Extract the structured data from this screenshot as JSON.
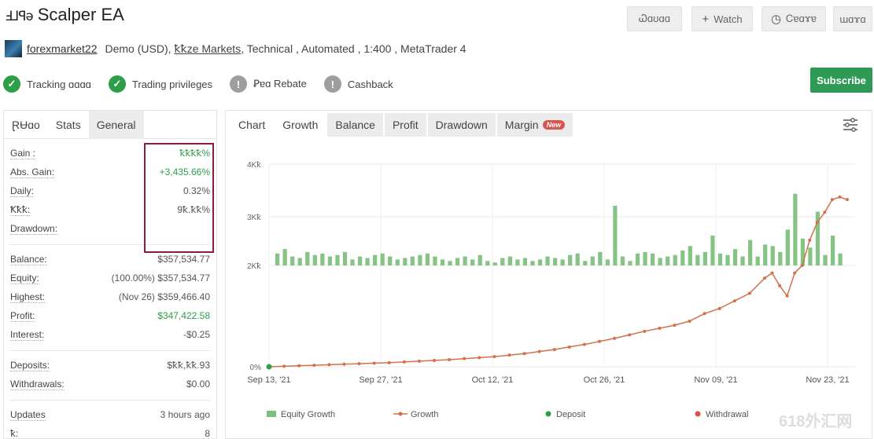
{
  "header": {
    "logo_text": "Ⅎ⅃ꟼǝ",
    "title": "Scalper EA"
  },
  "top_buttons": [
    {
      "label": "Ꮗɑʊɑɑ",
      "icon": ""
    },
    {
      "label": "Watch",
      "icon": "+"
    },
    {
      "label": "Ꮯɐɑɤɐ",
      "icon": "◷"
    },
    {
      "label": "ɯɑɤɑ",
      "icon": ""
    }
  ],
  "meta": {
    "username": "forexmarket22",
    "account": "Demo (USD),",
    "broker": "ꝁꝁze Markets",
    "rest": ", Technical , Automated , 1:400 , MetaTrader 4"
  },
  "badges": [
    {
      "label": "Tracking ɑɑɑɑ",
      "icon": "check-icon",
      "color": "#2e9e4a"
    },
    {
      "label": "Trading privileges",
      "icon": "check-icon",
      "color": "#2e9e4a"
    },
    {
      "label": "Ꝑɐɑ Rebate",
      "icon": "alert-icon",
      "color": "#9e9e9e"
    },
    {
      "label": "Cashback",
      "icon": "alert-icon",
      "color": "#9e9e9e"
    }
  ],
  "subscribe_label": "Subscribe",
  "left_tabs": [
    "ⱤɄɑo",
    "Stats",
    "General"
  ],
  "stats_top": [
    {
      "label": "Gain :",
      "value": "ꝁꝁꝁꝁ%",
      "green": true
    },
    {
      "label": "Abs. Gain:",
      "value": "+3,435.66%",
      "green": true
    },
    {
      "label": "Daily:",
      "value": "0.32%",
      "green": false
    },
    {
      "label": "Ꝁꝁꝁ:",
      "value": "9ꝁ.ꝁꝁ%",
      "green": false
    },
    {
      "label": "Drawdown:",
      "value": "",
      "green": false
    }
  ],
  "stats_balance": [
    {
      "label": "Balance:",
      "value": "$357,534.77",
      "green": false
    },
    {
      "label": "Equity:",
      "value": "(100.00%) $357,534.77",
      "green": false
    },
    {
      "label": "Highest:",
      "value": "(Nov 26) $359,466.40",
      "green": false
    },
    {
      "label": "Profit:",
      "value": "$347,422.58",
      "green": true
    },
    {
      "label": "Interest:",
      "value": "-$0.25",
      "green": false
    }
  ],
  "stats_deposits": [
    {
      "label": "Deposits:",
      "value": "$ꝁꝁ,ꝁꝁ.93",
      "green": false
    },
    {
      "label": "Withdrawals:",
      "value": "$0.00",
      "green": false
    }
  ],
  "stats_updates": [
    {
      "label": "Updates",
      "value": "3 hours ago",
      "green": false
    },
    {
      "label": "ꝁ:",
      "value": "8",
      "green": false
    }
  ],
  "right_tabs": [
    "Chart",
    "Growth",
    "Balance",
    "Profit",
    "Drawdown",
    "Margin"
  ],
  "new_badge": "New",
  "chart_data": {
    "type": "line",
    "y_ticks": [
      "4Kꝁ",
      "3Kꝁ",
      "2Kꝁ",
      "0%"
    ],
    "x_ticks": [
      "Sep 13, '21",
      "Sep 27, '21",
      "Oct 12, '21",
      "Oct 26, '21",
      "Nov 09, '21",
      "Nov 23, '21"
    ],
    "x_range": [
      0,
      77
    ],
    "y_range": [
      0,
      4000
    ],
    "growth_series": {
      "name": "Growth",
      "x": [
        0,
        2,
        4,
        6,
        8,
        10,
        12,
        14,
        16,
        18,
        20,
        22,
        24,
        26,
        28,
        30,
        32,
        34,
        36,
        38,
        40,
        42,
        44,
        46,
        48,
        50,
        52,
        54,
        56,
        58,
        60,
        62,
        64,
        66,
        67,
        68,
        69,
        70,
        71,
        72,
        73,
        74,
        75,
        76,
        77
      ],
      "y": [
        0,
        10,
        20,
        30,
        40,
        50,
        60,
        70,
        80,
        95,
        110,
        125,
        140,
        160,
        180,
        200,
        230,
        260,
        300,
        340,
        390,
        440,
        500,
        560,
        630,
        700,
        760,
        820,
        900,
        1050,
        1150,
        1300,
        1450,
        1750,
        1850,
        1600,
        1400,
        1850,
        2000,
        2500,
        2850,
        3050,
        3300,
        3350,
        3300
      ]
    },
    "bar_series": {
      "name": "Equity Growth",
      "values": [
        40,
        55,
        30,
        25,
        45,
        35,
        40,
        30,
        35,
        45,
        20,
        30,
        25,
        35,
        40,
        30,
        20,
        25,
        30,
        35,
        40,
        30,
        20,
        15,
        25,
        30,
        20,
        35,
        15,
        10,
        25,
        30,
        20,
        25,
        15,
        20,
        30,
        25,
        20,
        35,
        40,
        15,
        30,
        45,
        20,
        200,
        30,
        15,
        40,
        45,
        40,
        25,
        30,
        35,
        50,
        65,
        35,
        45,
        100,
        40,
        35,
        55,
        30,
        85,
        30,
        70,
        65,
        45,
        120,
        240,
        90,
        60,
        180,
        35,
        100,
        40
      ]
    },
    "legend": [
      {
        "name": "Equity Growth",
        "color": "#7cc07c"
      },
      {
        "name": "Growth",
        "color": "#d2714a"
      },
      {
        "name": "Deposit",
        "color": "#2e9e4a"
      },
      {
        "name": "Withdrawal",
        "color": "#d9534f"
      }
    ],
    "grid": true
  },
  "watermark": "618外汇网"
}
